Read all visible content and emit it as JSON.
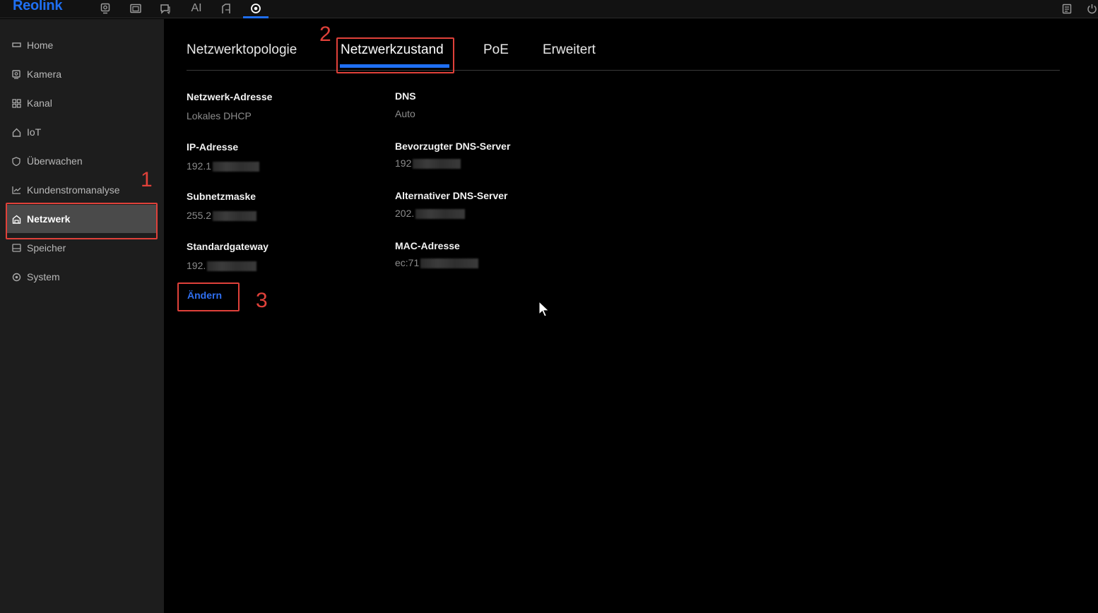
{
  "app": {
    "logo": "Reolink"
  },
  "topbar": {
    "ai_label": "AI"
  },
  "sidebar": {
    "items": [
      {
        "label": "Home",
        "icon": "home-icon"
      },
      {
        "label": "Kamera",
        "icon": "camera-icon"
      },
      {
        "label": "Kanal",
        "icon": "channel-grid-icon"
      },
      {
        "label": "IoT",
        "icon": "iot-house-icon"
      },
      {
        "label": "Überwachen",
        "icon": "shield-icon"
      },
      {
        "label": "Kundenstromanalyse",
        "icon": "chart-icon"
      },
      {
        "label": "Netzwerk",
        "icon": "network-icon",
        "active": true
      },
      {
        "label": "Speicher",
        "icon": "storage-icon"
      },
      {
        "label": "System",
        "icon": "system-gear-icon"
      }
    ]
  },
  "tabs": [
    {
      "label": "Netzwerktopologie"
    },
    {
      "label": "Netzwerkzustand",
      "active": true
    },
    {
      "label": "PoE"
    },
    {
      "label": "Erweitert"
    }
  ],
  "fields_left": [
    {
      "label": "Netzwerk-Adresse",
      "value": "Lokales DHCP"
    },
    {
      "label": "IP-Adresse",
      "value": "192.1"
    },
    {
      "label": "Subnetzmaske",
      "value": "255.2"
    },
    {
      "label": "Standardgateway",
      "value": "192."
    }
  ],
  "fields_right": [
    {
      "label": "DNS",
      "value": "Auto"
    },
    {
      "label": "Bevorzugter DNS-Server",
      "value": "192"
    },
    {
      "label": "Alternativer DNS-Server",
      "value": "202."
    },
    {
      "label": "MAC-Adresse",
      "value": "ec:71"
    }
  ],
  "change_button": {
    "label": "Ändern"
  },
  "annotations": [
    "1",
    "2",
    "3"
  ],
  "colors": {
    "accent": "#1f6ff2",
    "annotation": "#e0413a",
    "sidebar_bg": "#1d1d1d",
    "active_item_bg": "#4a4a4a"
  }
}
